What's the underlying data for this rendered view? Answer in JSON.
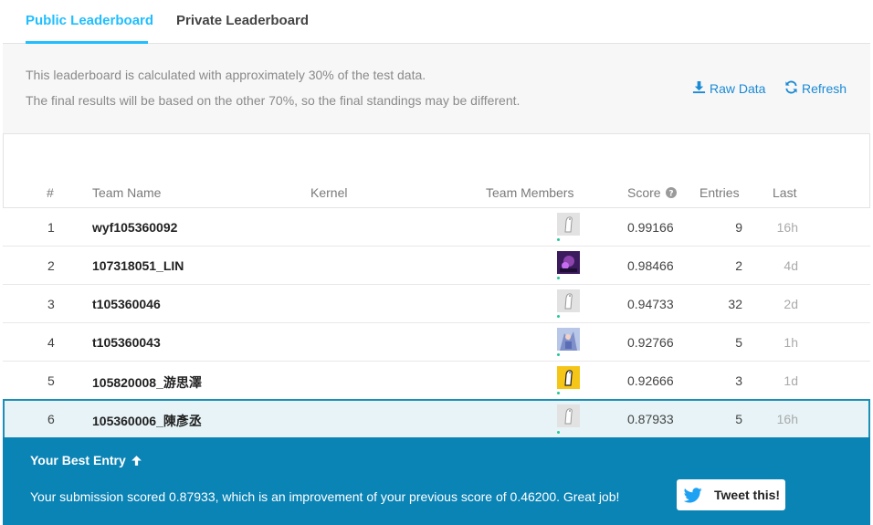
{
  "tabs": [
    {
      "label": "Public Leaderboard",
      "active": true
    },
    {
      "label": "Private Leaderboard",
      "active": false
    }
  ],
  "info": {
    "line1": "This leaderboard is calculated with approximately 30% of the test data.",
    "line2": "The final results will be based on the other 70%, so the final standings may be different.",
    "raw_data_label": "Raw Data",
    "refresh_label": "Refresh"
  },
  "table": {
    "headers": {
      "rank": "#",
      "team": "Team Name",
      "kernel": "Kernel",
      "members": "Team Members",
      "score": "Score",
      "entries": "Entries",
      "last": "Last"
    },
    "rows": [
      {
        "rank": "1",
        "team": "wyf105360092",
        "score": "0.99166",
        "entries": "9",
        "last": "16h",
        "avatar": "default-goose"
      },
      {
        "rank": "2",
        "team": "107318051_LIN",
        "score": "0.98466",
        "entries": "2",
        "last": "4d",
        "avatar": "purple-photo"
      },
      {
        "rank": "3",
        "team": "t105360046",
        "score": "0.94733",
        "entries": "32",
        "last": "2d",
        "avatar": "default-goose"
      },
      {
        "rank": "4",
        "team": "t105360043",
        "score": "0.92766",
        "entries": "5",
        "last": "1h",
        "avatar": "anime-photo"
      },
      {
        "rank": "5",
        "team": "105820008_游思澤",
        "score": "0.92666",
        "entries": "3",
        "last": "1d",
        "avatar": "yellow-goose"
      },
      {
        "rank": "6",
        "team": "105360006_陳彥丞",
        "score": "0.87933",
        "entries": "5",
        "last": "16h",
        "avatar": "default-goose",
        "highlight": true
      }
    ]
  },
  "best_entry": {
    "title": "Your Best Entry",
    "text": "Your submission scored 0.87933, which is an improvement of your previous score of 0.46200. Great job!",
    "tweet_label": "Tweet this!"
  },
  "colors": {
    "accent": "#20BEFF",
    "link": "#1a8ad6",
    "best_bg": "#0a83b5",
    "highlight_bg": "#e7f3f7",
    "highlight_border": "#1b8fb6",
    "twitter": "#1DA1F2"
  }
}
